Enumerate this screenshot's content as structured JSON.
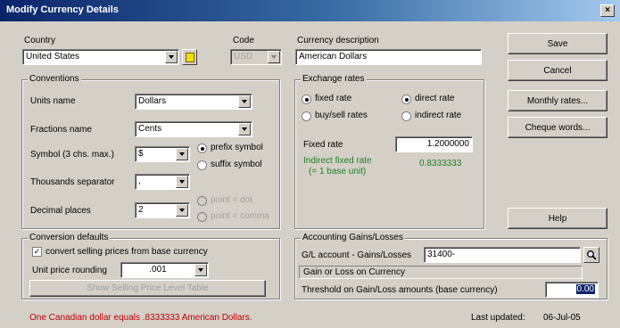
{
  "window": {
    "title": "Modify Currency Details",
    "close": "×"
  },
  "country": {
    "label": "Country",
    "value": "United States"
  },
  "code": {
    "label": "Code",
    "value": "USD"
  },
  "description": {
    "label": "Currency description",
    "value": "American Dollars"
  },
  "conventions": {
    "title": "Conventions",
    "units_label": "Units name",
    "units_value": "Dollars",
    "fractions_label": "Fractions name",
    "fractions_value": "Cents",
    "symbol_label": "Symbol (3 chs. max.)",
    "symbol_value": "$",
    "prefix_label": "prefix symbol",
    "suffix_label": "suffix symbol",
    "thousands_label": "Thousands separator",
    "thousands_value": ",",
    "decimal_label": "Decimal places",
    "decimal_value": "2",
    "point_label": "point = dot",
    "comma_label": "point = comma"
  },
  "exchange": {
    "title": "Exchange rates",
    "fixed_label": "fixed rate",
    "buysell_label": "buy/sell rates",
    "direct_label": "direct rate",
    "indirect_label": "indirect rate",
    "fixed_rate_label": "Fixed rate",
    "fixed_rate_value": "1.2000000",
    "indirect_label1": "Indirect fixed rate",
    "indirect_label2": "(= 1 base unit)",
    "indirect_value": "0.8333333"
  },
  "buttons": {
    "save": "Save",
    "cancel": "Cancel",
    "monthly": "Monthly rates...",
    "cheque": "Cheque words...",
    "help": "Help"
  },
  "conversion": {
    "title": "Conversion defaults",
    "convert_label": "convert selling prices from base currency",
    "rounding_label": "Unit price rounding",
    "rounding_value": ".001",
    "show_button": "Show Selling Price Level Table"
  },
  "accounting": {
    "title": "Accounting Gains/Losses",
    "account_label": "G/L account - Gains/Losses",
    "account_value": "31400-",
    "account_name": "Gain or Loss on Currency",
    "threshold_label": "Threshold on Gain/Loss amounts (base currency)",
    "threshold_value": "0.00"
  },
  "footer": {
    "equals_text": "One Canadian dollar equals .8333333 American Dollars.",
    "last_updated_label": "Last updated:",
    "last_updated_value": "06-Jul-05"
  },
  "colors": {
    "title_start": "#0a246a",
    "title_end": "#a6caf0",
    "indirect_text": "#208020",
    "footer_text": "#c00000"
  },
  "icons": {
    "close": "close-icon",
    "note": "note-icon",
    "lookup": "magnifier-icon",
    "dropdown": "chevron-down-icon"
  }
}
